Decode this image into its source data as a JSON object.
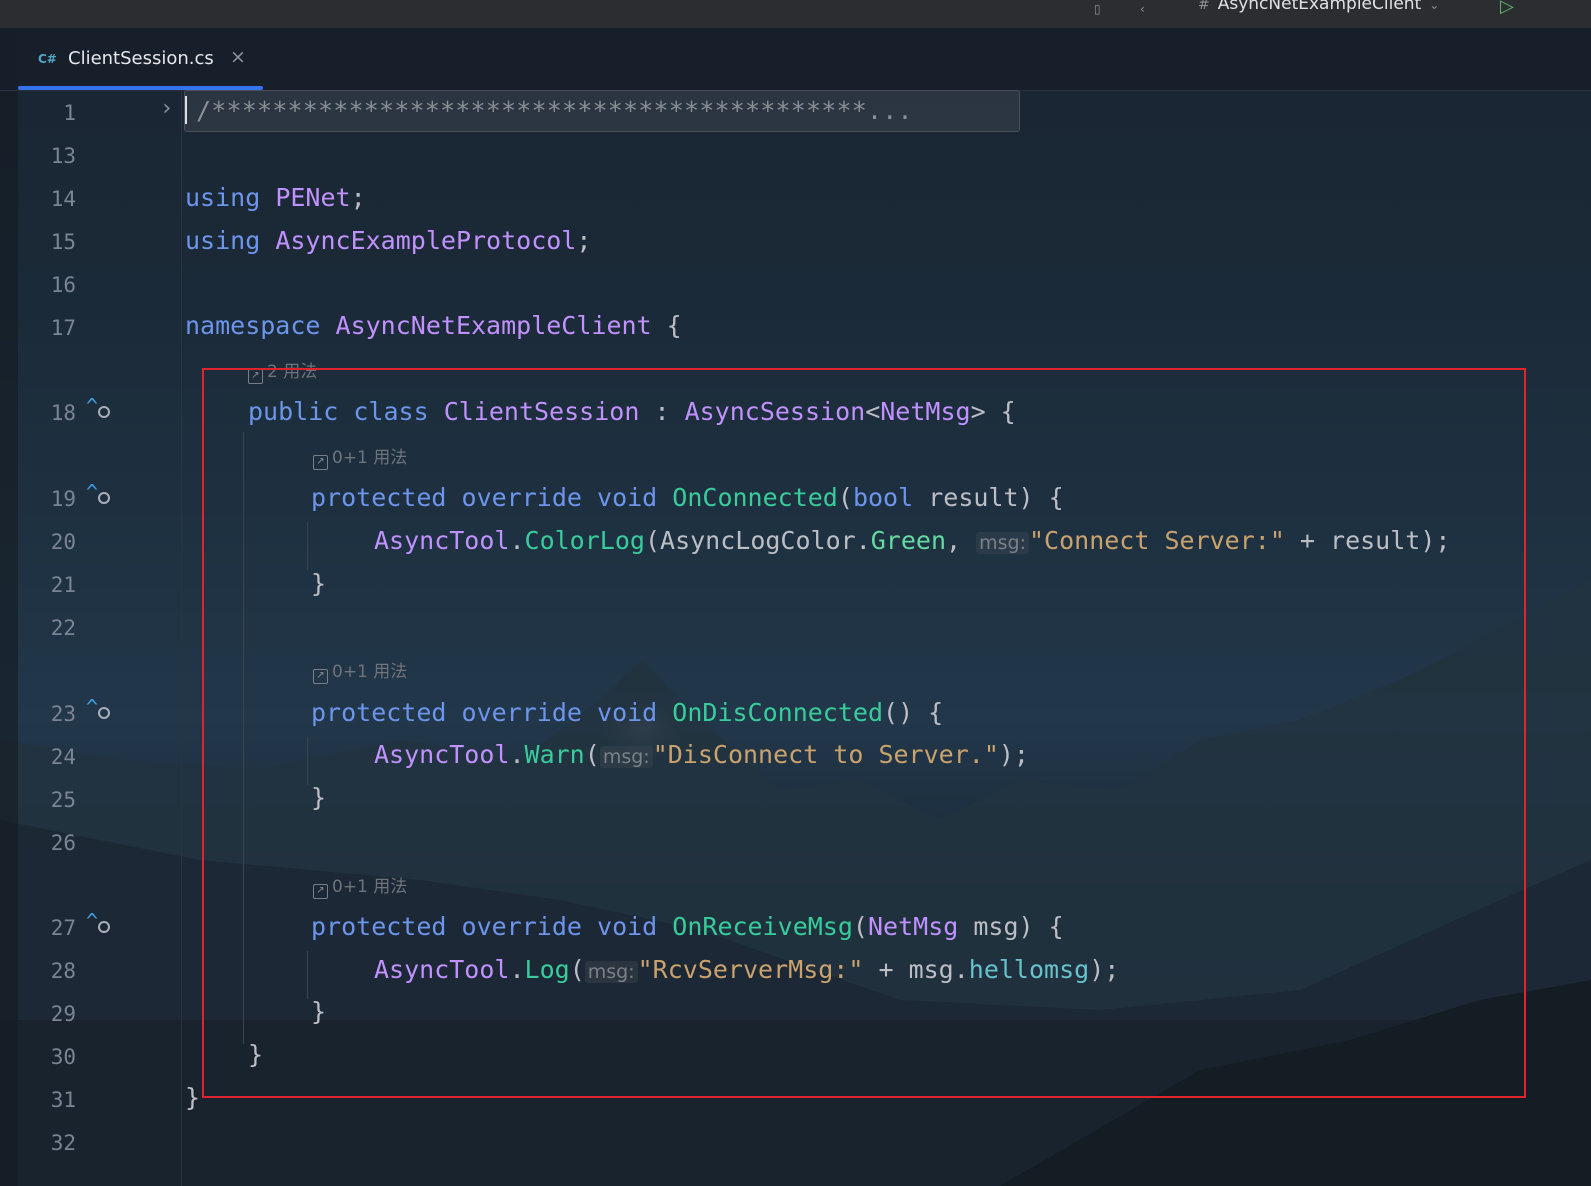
{
  "window": {
    "run_config": "AsyncNetExampleClient",
    "run_config_prefix": "#"
  },
  "tab": {
    "lang_badge": "C#",
    "file_name": "ClientSession.cs",
    "close_glyph": "×"
  },
  "icons": {
    "fold": "chevron-right-icon",
    "override": "override-arrow-icon",
    "usage": "usage-link-icon"
  },
  "colors": {
    "keyword": "#6c95eb",
    "type": "#c191ff",
    "method": "#39cc9b",
    "string": "#c9a26d",
    "highlight_box": "#e0242e",
    "tab_underline": "#3574f0"
  },
  "line_numbers": [
    "1",
    "13",
    "14",
    "15",
    "16",
    "17",
    "18",
    "19",
    "20",
    "21",
    "22",
    "23",
    "24",
    "25",
    "26",
    "27",
    "28",
    "29",
    "30",
    "31",
    "32"
  ],
  "hints": {
    "class_usage": "2 用法",
    "connected_usage": "0+1 用法",
    "disconnected_usage": "0+1 用法",
    "receive_usage": "0+1 用法"
  },
  "code": {
    "l1": "/*******************************************...",
    "l14_kw": "using",
    "l14_ns": "PENet",
    "l15_kw": "using",
    "l15_ns": "AsyncExampleProtocol",
    "l17_kw": "namespace",
    "l17_ns": "AsyncNetExampleClient",
    "l18_kw1": "public",
    "l18_kw2": "class",
    "l18_name": "ClientSession",
    "l18_base": "AsyncSession",
    "l18_generic": "NetMsg",
    "m1_kw1": "protected",
    "m1_kw2": "override",
    "m1_kw3": "void",
    "m1_name": "OnConnected",
    "m1_ptype": "bool",
    "m1_pname": "result",
    "l20_cls": "AsyncTool",
    "l20_fn": "ColorLog",
    "l20_enum": "AsyncLogColor",
    "l20_member": "Green",
    "l20_hint": "msg:",
    "l20_str": "\"Connect Server:\"",
    "l20_tail": "result",
    "m2_kw1": "protected",
    "m2_kw2": "override",
    "m2_kw3": "void",
    "m2_name": "OnDisConnected",
    "l24_cls": "AsyncTool",
    "l24_fn": "Warn",
    "l24_hint": "msg:",
    "l24_str": "\"DisConnect to Server.\"",
    "m3_kw1": "protected",
    "m3_kw2": "override",
    "m3_kw3": "void",
    "m3_name": "OnReceiveMsg",
    "m3_ptype": "NetMsg",
    "m3_pname": "msg",
    "l28_cls": "AsyncTool",
    "l28_fn": "Log",
    "l28_hint": "msg:",
    "l28_str": "\"RcvServerMsg:\"",
    "l28_obj": "msg",
    "l28_field": "hellomsg"
  }
}
